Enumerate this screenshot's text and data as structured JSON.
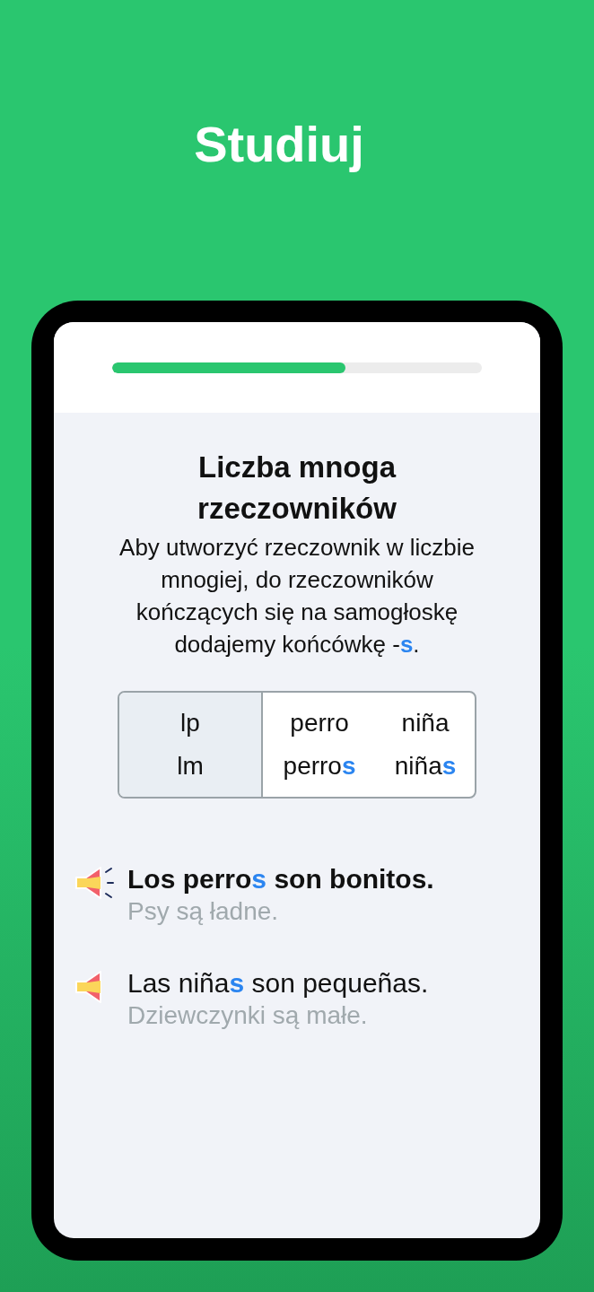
{
  "title": "Studiuj",
  "progress": {
    "level": 0.63
  },
  "lesson": {
    "heading": "Liczba mnoga rzeczowników",
    "text": "Aby utworzyć rzeczownik w liczbie mnogiej, do rzeczowników kończących się na samogłoskę dodajemy końcówkę -**s**."
  },
  "table": {
    "rows": [
      {
        "label": "lp",
        "cells": [
          "perro",
          "niña"
        ]
      },
      {
        "label": "lm",
        "cells": [
          "perro**s**",
          "niña**s**"
        ]
      }
    ]
  },
  "examples": [
    {
      "sentence": "Los perro**s** son bonitos.",
      "translation": "Psy są ładne.",
      "playing": true
    },
    {
      "sentence": "Las niña**s** son pequeñas.",
      "translation": "Dziewczynki są małe.",
      "playing": false
    }
  ]
}
